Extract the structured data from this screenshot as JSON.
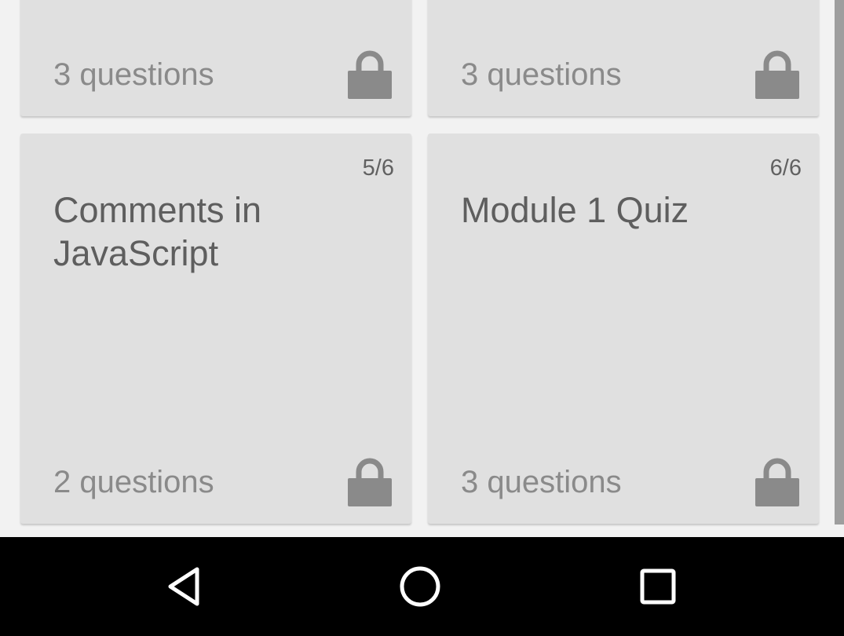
{
  "cards": [
    {
      "number": "",
      "title": "",
      "count": "3 questions",
      "locked": true
    },
    {
      "number": "",
      "title": "",
      "count": "3 questions",
      "locked": true
    },
    {
      "number": "5/6",
      "title": "Comments in JavaScript",
      "count": "2 questions",
      "locked": true
    },
    {
      "number": "6/6",
      "title": "Module 1 Quiz",
      "count": "3 questions",
      "locked": true
    }
  ],
  "icons": {
    "lock": "lock-icon",
    "back": "back-icon",
    "home": "home-icon",
    "recents": "recents-icon"
  },
  "colors": {
    "card_bg": "#e0e0e0",
    "page_bg": "#f2f2f2",
    "lock": "#8a8a8a",
    "navbar": "#000000"
  }
}
